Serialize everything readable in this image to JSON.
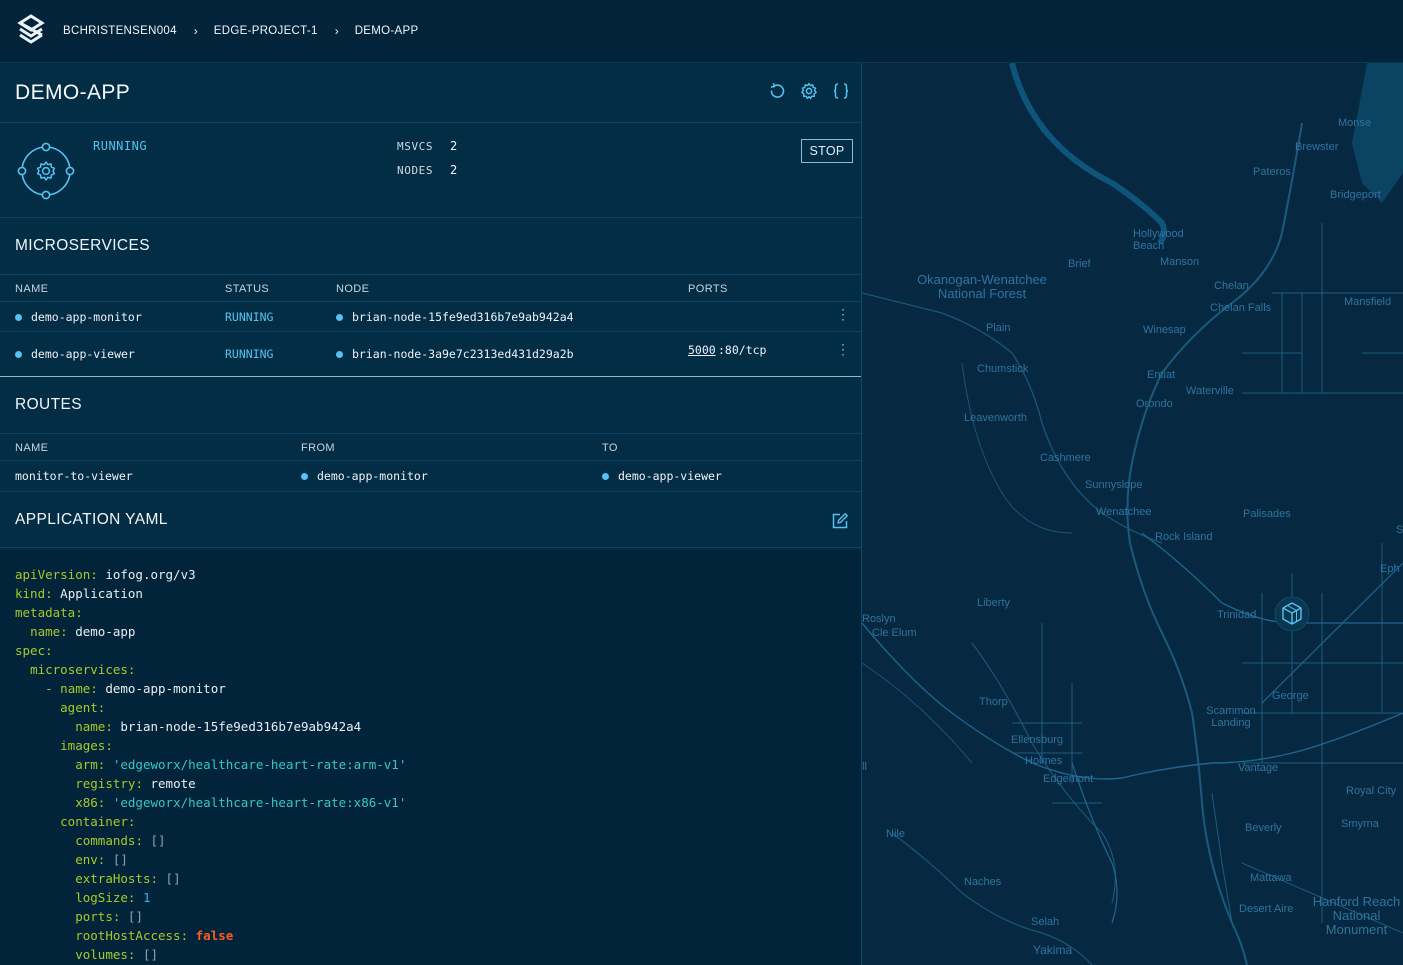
{
  "breadcrumb": [
    "BCHRISTENSEN004",
    "EDGE-PROJECT-1",
    "DEMO-APP"
  ],
  "breadcrumb_sep": "›",
  "app": {
    "title": "DEMO-APP",
    "status": "RUNNING",
    "msvcs_label": "MSVCS",
    "msvcs_value": "2",
    "nodes_label": "NODES",
    "nodes_value": "2",
    "stop_label": "STOP"
  },
  "icons": {
    "header": [
      "refresh-icon",
      "gear-icon",
      "braces-icon"
    ],
    "status": "app-gear-icon",
    "yaml_edit": "edit-icon",
    "map_marker": "cube-icon"
  },
  "microservices": {
    "title": "MICROSERVICES",
    "columns": [
      "NAME",
      "STATUS",
      "NODE",
      "PORTS"
    ],
    "rows": [
      {
        "name": "demo-app-monitor",
        "status": "RUNNING",
        "node": "brian-node-15fe9ed316b7e9ab942a4",
        "port_link": "",
        "port_rest": ""
      },
      {
        "name": "demo-app-viewer",
        "status": "RUNNING",
        "node": "brian-node-3a9e7c2313ed431d29a2b",
        "port_link": "5000",
        "port_rest": ":80/tcp"
      }
    ]
  },
  "routes": {
    "title": "ROUTES",
    "columns": [
      "NAME",
      "FROM",
      "TO"
    ],
    "rows": [
      {
        "name": "monitor-to-viewer",
        "from": "demo-app-monitor",
        "to": "demo-app-viewer"
      }
    ]
  },
  "yaml": {
    "title": "APPLICATION YAML",
    "lines": [
      {
        "indent": 0,
        "key": "apiVersion",
        "value": "iofog.org/v3",
        "type": "v"
      },
      {
        "indent": 0,
        "key": "kind",
        "value": "Application",
        "type": "v"
      },
      {
        "indent": 0,
        "key": "metadata",
        "value": "",
        "type": "v"
      },
      {
        "indent": 1,
        "key": "name",
        "value": "demo-app",
        "type": "v"
      },
      {
        "indent": 0,
        "key": "spec",
        "value": "",
        "type": "v"
      },
      {
        "indent": 1,
        "key": "microservices",
        "value": "",
        "type": "v"
      },
      {
        "indent": 2,
        "dash": true,
        "key": "name",
        "value": "demo-app-monitor",
        "type": "v"
      },
      {
        "indent": 3,
        "key": "agent",
        "value": "",
        "type": "v"
      },
      {
        "indent": 4,
        "key": "name",
        "value": "brian-node-15fe9ed316b7e9ab942a4",
        "type": "v"
      },
      {
        "indent": 3,
        "key": "images",
        "value": "",
        "type": "v"
      },
      {
        "indent": 4,
        "key": "arm",
        "value": "'edgeworx/healthcare-heart-rate:arm-v1'",
        "type": "s"
      },
      {
        "indent": 4,
        "key": "registry",
        "value": "remote",
        "type": "v"
      },
      {
        "indent": 4,
        "key": "x86",
        "value": "'edgeworx/healthcare-heart-rate:x86-v1'",
        "type": "s"
      },
      {
        "indent": 3,
        "key": "container",
        "value": "",
        "type": "v"
      },
      {
        "indent": 4,
        "key": "commands",
        "value": "[]",
        "type": "br"
      },
      {
        "indent": 4,
        "key": "env",
        "value": "[]",
        "type": "br"
      },
      {
        "indent": 4,
        "key": "extraHosts",
        "value": "[]",
        "type": "br"
      },
      {
        "indent": 4,
        "key": "logSize",
        "value": "1",
        "type": "n"
      },
      {
        "indent": 4,
        "key": "ports",
        "value": "[]",
        "type": "br"
      },
      {
        "indent": 4,
        "key": "rootHostAccess",
        "value": "false",
        "type": "b"
      },
      {
        "indent": 4,
        "key": "volumes",
        "value": "[]",
        "type": "br"
      }
    ]
  },
  "map": {
    "places": [
      "Monse",
      "Brewster",
      "Pateros",
      "Bridgeport",
      "Hollywood Beach",
      "Manson",
      "Brief",
      "Okanogan-Wenatchee National Forest",
      "Chelan",
      "Chelan Falls",
      "Mansfield",
      "Plain",
      "Winesap",
      "Chumstick",
      "Entiat",
      "Waterville",
      "Orondo",
      "Leavenworth",
      "Cashmere",
      "Sunnyslope",
      "Wenatchee",
      "Palisades",
      "Rock Island",
      "Liberty",
      "Trinidad",
      "Roslyn",
      "Cle Elum",
      "Thorp",
      "George",
      "Scammon Landing",
      "Ellensburg",
      "Holmes",
      "Edgemont",
      "Vantage",
      "Royal City",
      "Nile",
      "Beverly",
      "Smyrna",
      "Mattawa",
      "Naches",
      "Desert Aire",
      "Hanford Reach National Monument",
      "Selah",
      "Yakima",
      "Eph",
      "ll",
      "S"
    ]
  }
}
